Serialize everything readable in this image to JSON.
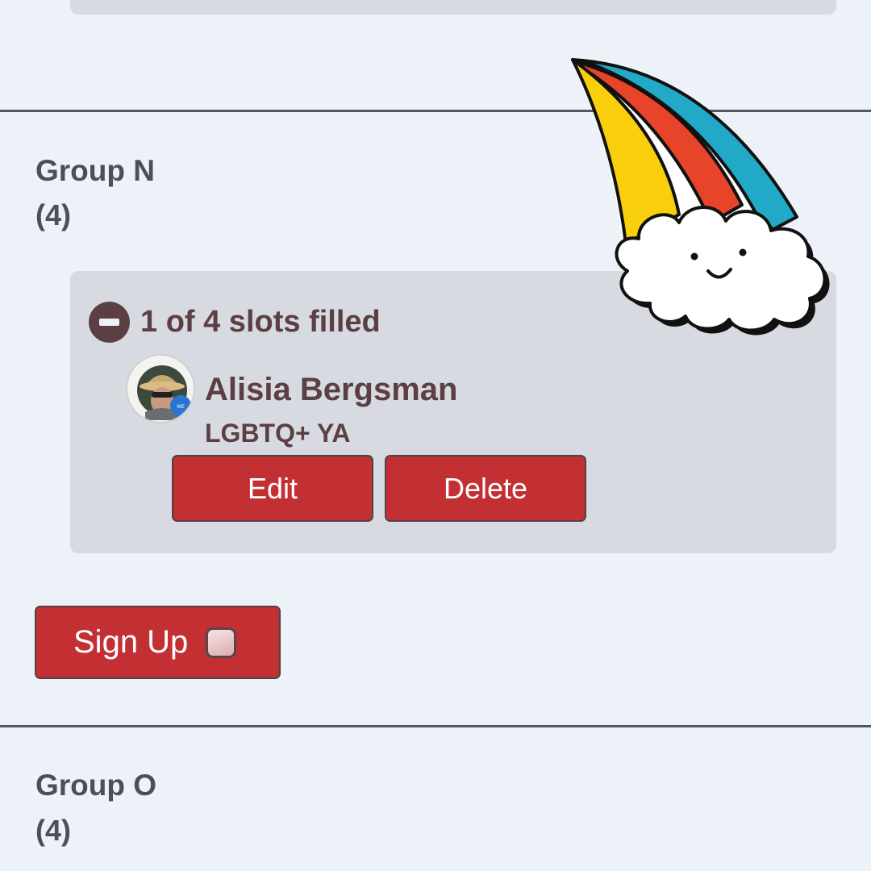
{
  "groups": [
    {
      "title": "Group N",
      "count": "(4)",
      "slots": {
        "status": "1 of 4 slots filled",
        "entries": [
          {
            "name": "Alisia Bergsman",
            "tag": "LGBTQ+ YA",
            "edit_label": "Edit",
            "delete_label": "Delete"
          }
        ]
      },
      "signup_label": "Sign Up"
    },
    {
      "title": "Group O",
      "count": "(4)"
    }
  ],
  "icons": {
    "status": "minus-circle-icon",
    "signup": "checkbox-icon",
    "sticker": "rainbow-cloud-sticker"
  },
  "colors": {
    "background": "#edf1f8",
    "card": "#d7dbe1",
    "button": "#c33034",
    "text_dark": "#4b4f56",
    "text_accent": "#5c3f43"
  }
}
